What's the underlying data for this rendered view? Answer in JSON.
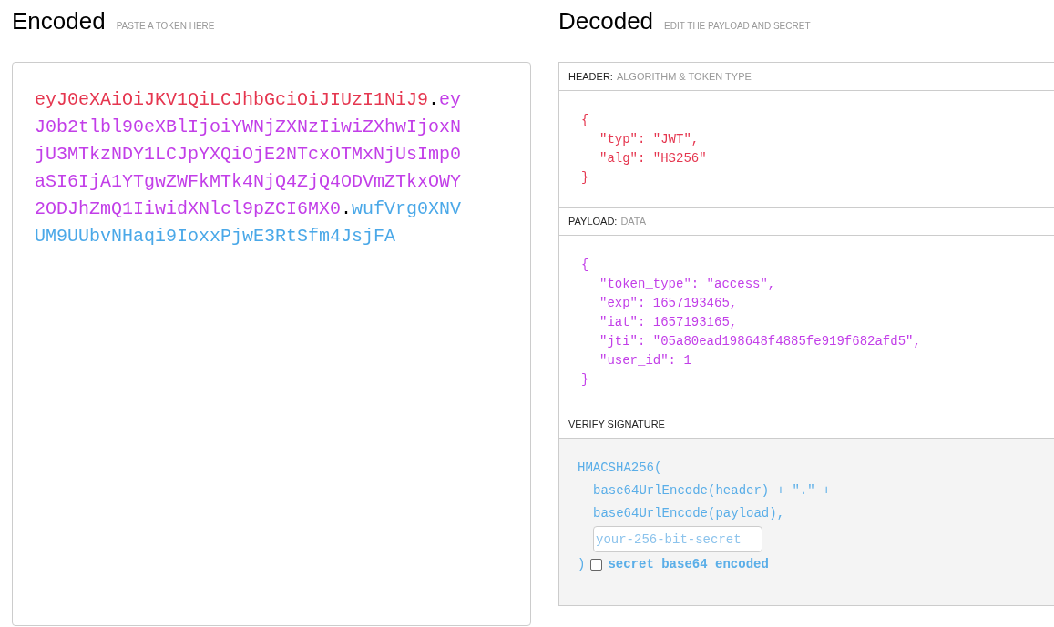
{
  "encoded": {
    "title": "Encoded",
    "subtitle": "PASTE A TOKEN HERE",
    "parts": [
      {
        "kind": "header",
        "text": "eyJ0eXAiOiJKV1QiLCJhbGciOiJIUzI1NiJ9"
      },
      {
        "kind": "dot",
        "text": "."
      },
      {
        "kind": "payload",
        "text": "eyJ0b2tlbl90eXBlIjoiYWNjZXNzIiwiZXhwIjoxNjU3MTkzNDY1LCJpYXQiOjE2NTcxOTMxNjUsImp0aSI6IjA1YTgwZWFkMTk4NjQ4ZjQ4ODVmZTkxOWY2ODJhZmQ1IiwidXNlcl9pZCI6MX0"
      },
      {
        "kind": "dot",
        "text": "."
      },
      {
        "kind": "signature",
        "text": "wufVrg0XNVUM9UUbvNHaqi9IoxxPjwE3RtSfm4JsjFA"
      }
    ]
  },
  "decoded": {
    "title": "Decoded",
    "subtitle": "EDIT THE PAYLOAD AND SECRET",
    "sections": [
      {
        "kind": "header",
        "label": "HEADER:",
        "sublabel": "ALGORITHM & TOKEN TYPE",
        "open": "{",
        "entries": [
          "\"typ\": \"JWT\",",
          "\"alg\": \"HS256\""
        ],
        "close": "}"
      },
      {
        "kind": "payload",
        "label": "PAYLOAD:",
        "sublabel": "DATA",
        "open": "{",
        "entries": [
          "\"token_type\": \"access\",",
          "\"exp\": 1657193465,",
          "\"iat\": 1657193165,",
          "\"jti\": \"05a80ead198648f4885fe919f682afd5\",",
          "\"user_id\": 1"
        ],
        "close": "}"
      }
    ],
    "verify": {
      "label": "VERIFY SIGNATURE",
      "open": "HMACSHA256(",
      "lines": [
        "base64UrlEncode(header) + \".\" +",
        "base64UrlEncode(payload),"
      ],
      "secret_placeholder": "your-256-bit-secret",
      "close": ")",
      "base64_label": "secret base64 encoded",
      "base64_checked": false
    }
  }
}
